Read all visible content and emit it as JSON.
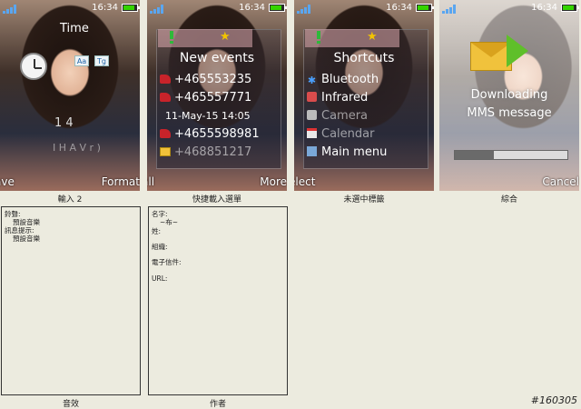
{
  "status_bar": {
    "time": "16:34"
  },
  "screens": [
    {
      "title": "Time",
      "badges": [
        "Aa",
        "Tg"
      ],
      "numbers": "1 4",
      "faded_text": "I H A V r )",
      "softkeys": {
        "left": "ave",
        "right": "Format"
      },
      "caption": "輸入 2"
    },
    {
      "title": "New events",
      "events": [
        {
          "icon": "missed-call-icon",
          "text": "+465553235"
        },
        {
          "icon": "missed-call-icon",
          "text": "+465557771"
        },
        {
          "icon": "none",
          "text": "11-May-15 14:05"
        },
        {
          "icon": "missed-call-icon",
          "text": "+4655598981"
        },
        {
          "icon": "message-icon",
          "text": "+468851217"
        }
      ],
      "softkeys": {
        "left": "all",
        "right": "More"
      },
      "caption": "快捷載入選單"
    },
    {
      "title": "Shortcuts",
      "items": [
        {
          "icon": "bluetooth-icon",
          "label": "Bluetooth"
        },
        {
          "icon": "infrared-icon",
          "label": "Infrared"
        },
        {
          "icon": "camera-icon",
          "label": "Camera"
        },
        {
          "icon": "calendar-icon",
          "label": "Calendar"
        },
        {
          "icon": "main-menu-icon",
          "label": "Main menu"
        }
      ],
      "softkeys": {
        "left": "elect",
        "right": ""
      },
      "caption": "未選中標籤"
    },
    {
      "lines": [
        "Downloading",
        "MMS message"
      ],
      "progress": 0.35,
      "softkeys": {
        "left": "",
        "right": "Cancel"
      },
      "caption": "綜合"
    }
  ],
  "boxes": [
    {
      "caption": "音效",
      "lines": [
        "鈴聲:",
        "預設音樂",
        "訊息提示:",
        "預設音樂"
      ]
    },
    {
      "caption": "作者",
      "lines": [
        "名字:",
        "~布~",
        "姓:",
        "組織:",
        "電子信件:",
        "URL:"
      ]
    }
  ],
  "watermark": "#160305",
  "colors": {
    "background": "#ecebdf",
    "signal": "#5aa6f0",
    "battery": "#34d400",
    "highlight": "#2fb83a",
    "star": "#f2c400"
  }
}
